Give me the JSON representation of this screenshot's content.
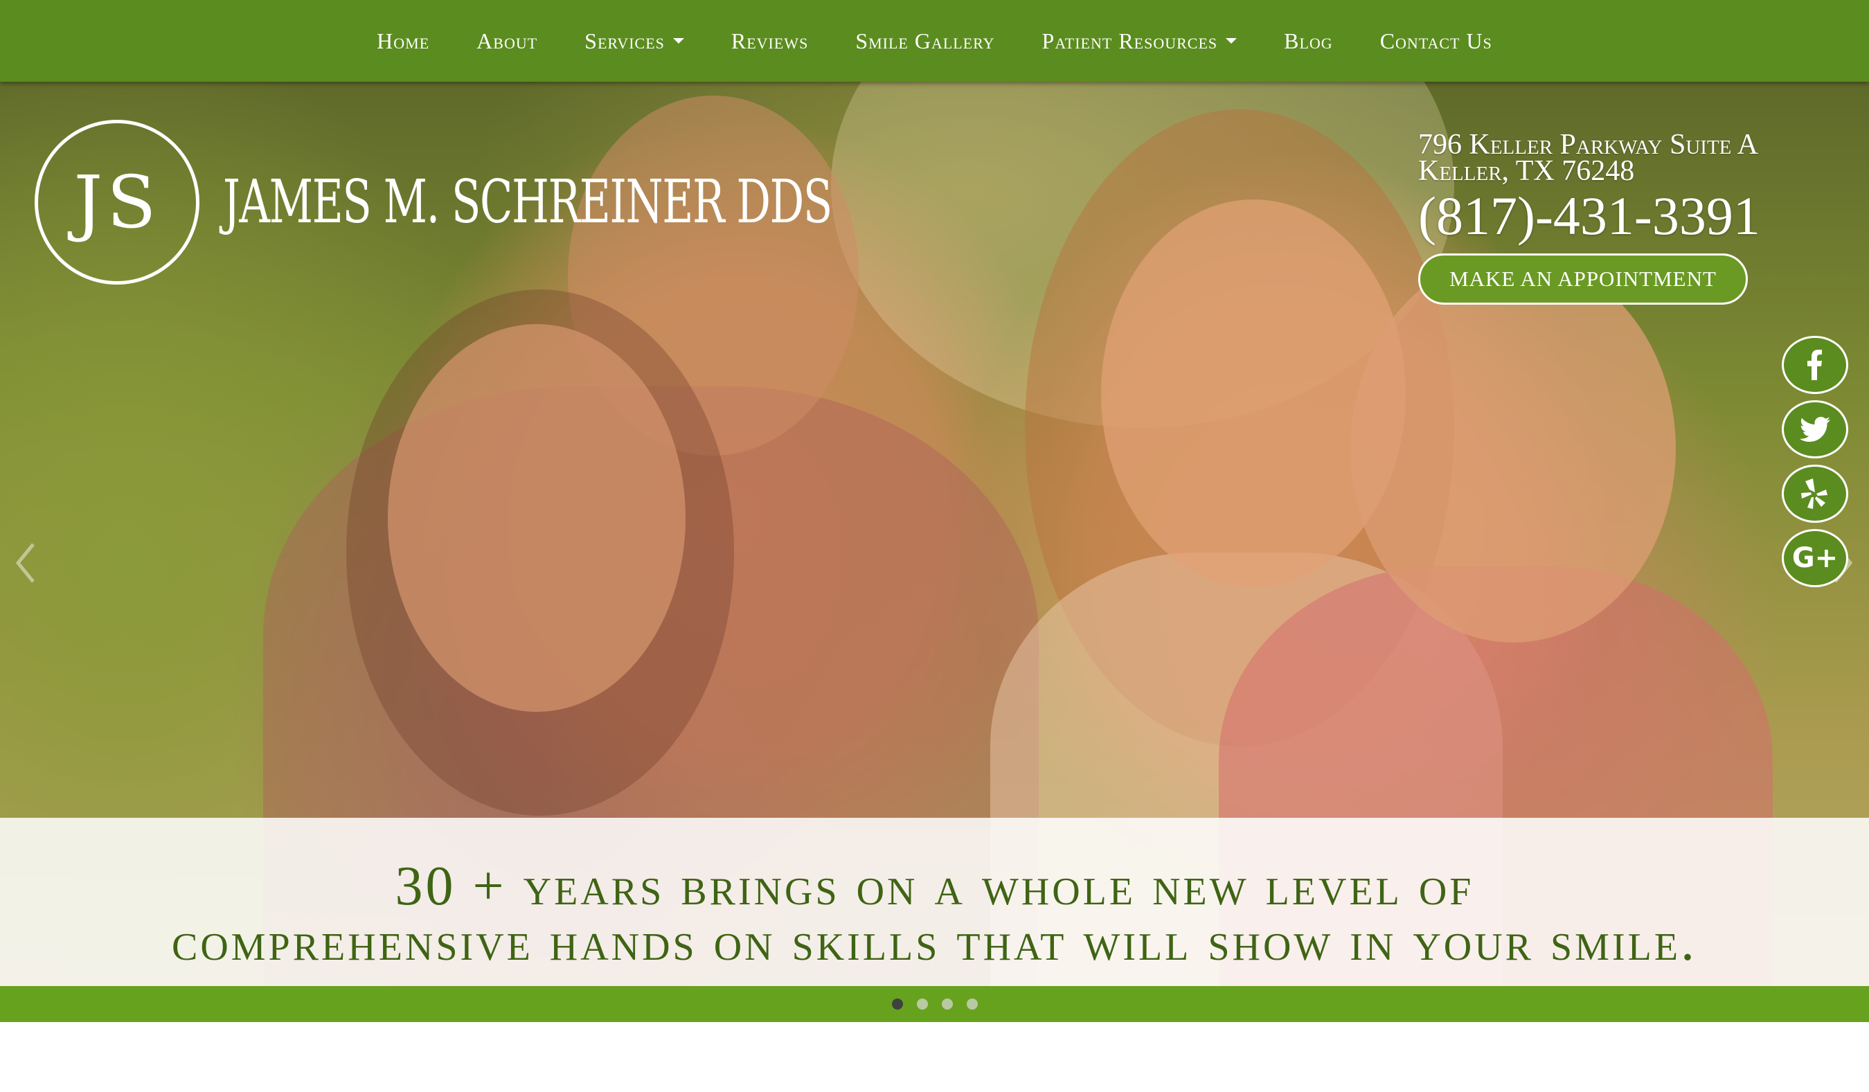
{
  "nav": {
    "items": [
      {
        "label": "Home",
        "dropdown": false
      },
      {
        "label": "About",
        "dropdown": false
      },
      {
        "label": "Services",
        "dropdown": true
      },
      {
        "label": "Reviews",
        "dropdown": false
      },
      {
        "label": "Smile Gallery",
        "dropdown": false
      },
      {
        "label": "Patient Resources",
        "dropdown": true
      },
      {
        "label": "Blog",
        "dropdown": false
      },
      {
        "label": "Contact Us",
        "dropdown": false
      }
    ]
  },
  "logo": {
    "monogram": "JS",
    "name": "JAMES M. SCHREINER DDS"
  },
  "contact": {
    "address_line1": "796 Keller Parkway Suite A",
    "address_line2": "Keller, TX 76248",
    "phone": "(817)-431-3391",
    "appointment_label": "MAKE AN APPOINTMENT"
  },
  "social": [
    {
      "name": "facebook",
      "icon": "facebook-icon"
    },
    {
      "name": "twitter",
      "icon": "twitter-icon"
    },
    {
      "name": "yelp",
      "icon": "yelp-icon"
    },
    {
      "name": "google-plus",
      "icon": "google-plus-icon"
    }
  ],
  "hero": {
    "tagline_line1": "30 + years brings on a whole new level of",
    "tagline_line2": "comprehensive hands on skills that will show in your smile."
  },
  "carousel": {
    "slide_count": 4,
    "active_index": 0
  },
  "colors": {
    "brand_green": "#5b8c1f",
    "bar_green": "#67a21e",
    "tagline_green": "#3f6414"
  }
}
